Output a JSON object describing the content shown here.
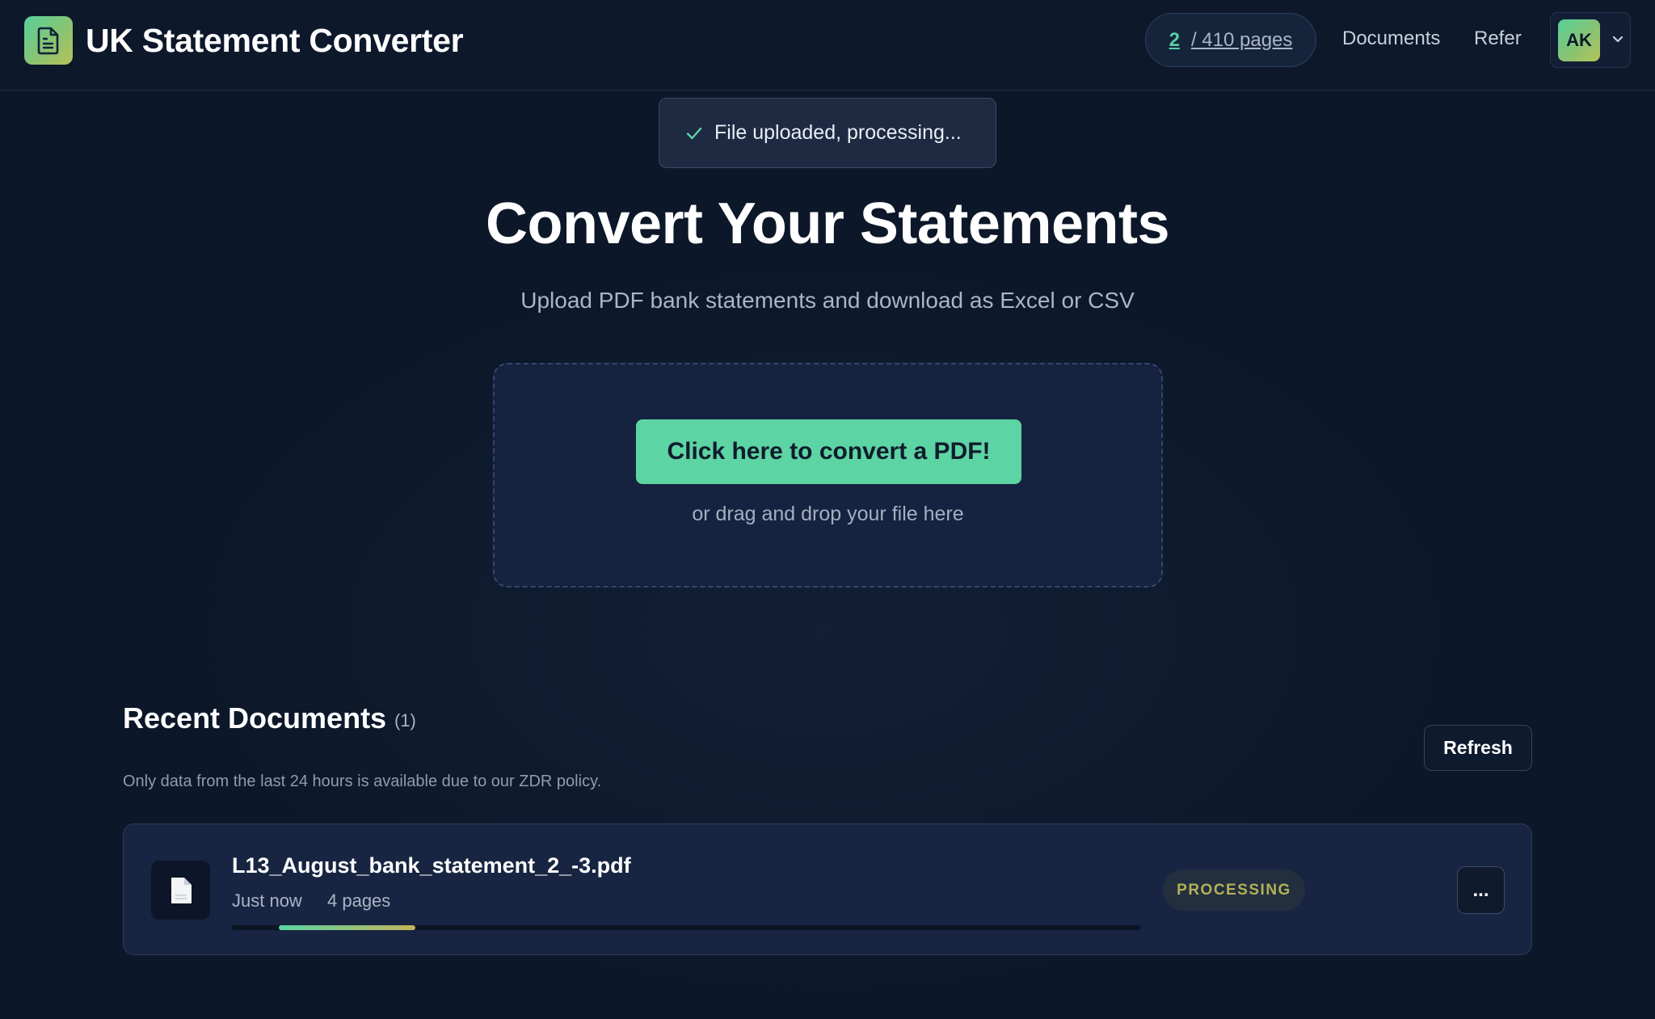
{
  "header": {
    "app_title": "UK Statement Converter",
    "pages_used": "2",
    "pages_total": "/ 410 pages",
    "nav": {
      "documents": "Documents",
      "refer": "Refer"
    },
    "user_initials": "AK"
  },
  "toast": {
    "message": "File uploaded, processing..."
  },
  "hero": {
    "title": "Convert Your Statements",
    "subtitle": "Upload PDF bank statements and download as Excel or CSV"
  },
  "dropzone": {
    "button_label": "Click here to convert a PDF!",
    "hint": "or drag and drop your file here"
  },
  "recent": {
    "title": "Recent Documents",
    "count": "(1)",
    "refresh_label": "Refresh",
    "note": "Only data from the last 24 hours is available due to our ZDR policy.",
    "documents": [
      {
        "name": "L13_August_bank_statement_2_-3.pdf",
        "time": "Just now",
        "pages": "4 pages",
        "status": "PROCESSING",
        "progress": 0.15,
        "more_label": "..."
      }
    ]
  },
  "colors": {
    "background": "#0c1729",
    "accent": "#5dd4a3",
    "status_processing": "#b3b055"
  },
  "icons": {
    "logo": "document-icon",
    "toast": "check-icon",
    "user_menu": "chevron-down-icon",
    "file": "file-icon"
  }
}
